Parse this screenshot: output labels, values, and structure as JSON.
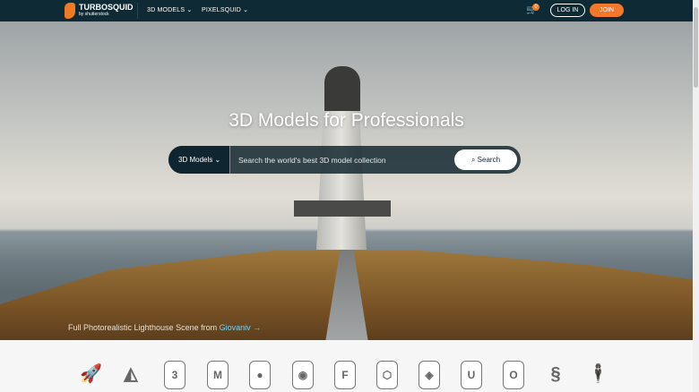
{
  "header": {
    "brand": "TURBOSQUID",
    "brand_sub": "by shutterstock",
    "nav": [
      "3D MODELS",
      "PIXELSQUID"
    ],
    "cart_count": "0",
    "login": "LOG IN",
    "join": "JOIN"
  },
  "hero": {
    "title": "3D Models for Professionals",
    "search": {
      "category": "3D Models",
      "placeholder": "Search the world's best 3D model collection",
      "button": "Search"
    },
    "credit": {
      "text": "Full Photorealistic Lighthouse Scene from ",
      "author": "Giovaniv"
    }
  },
  "formats": [
    {
      "icon": "rocket-icon",
      "glyph": "🚀"
    },
    {
      "icon": "shapes-icon",
      "glyph": "◭"
    },
    {
      "icon": "3ds-max-icon",
      "glyph": "3"
    },
    {
      "icon": "maya-icon",
      "glyph": "M"
    },
    {
      "icon": "cinema4d-icon",
      "glyph": "●"
    },
    {
      "icon": "blender-icon",
      "glyph": "◉"
    },
    {
      "icon": "fbx-icon",
      "glyph": "F"
    },
    {
      "icon": "obj-icon",
      "glyph": "⬡"
    },
    {
      "icon": "unity-icon",
      "glyph": "◈"
    },
    {
      "icon": "unreal-icon",
      "glyph": "U"
    },
    {
      "icon": "other-format-icon",
      "glyph": "O"
    },
    {
      "icon": "seahorse-icon",
      "glyph": "§"
    },
    {
      "icon": "rigged-human-icon",
      "glyph": "🕴"
    }
  ]
}
